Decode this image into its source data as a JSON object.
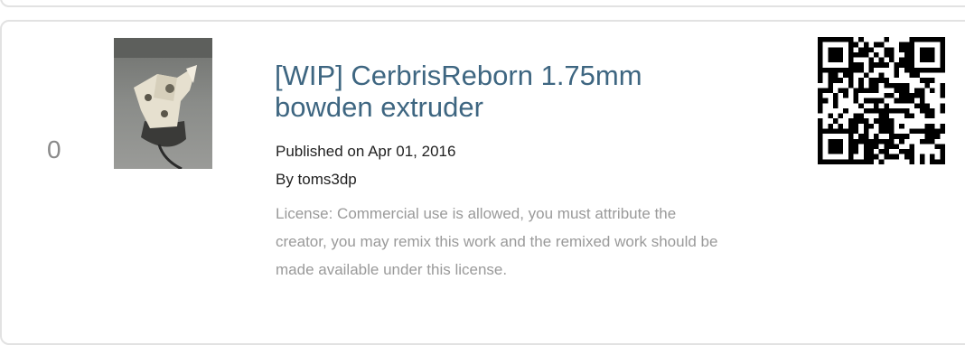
{
  "item": {
    "index": "0",
    "title": "[WIP] CerbrisReborn 1.75mm bowden extruder",
    "published": "Published on Apr 01, 2016",
    "author": "By toms3dp",
    "license": "License: Commercial use is allowed, you must attribute the creator, you may remix this work and the remixed work should be made available under this license."
  },
  "colors": {
    "title": "#3e6681",
    "license": "#9a9a9a",
    "border": "#e2e2e2"
  }
}
